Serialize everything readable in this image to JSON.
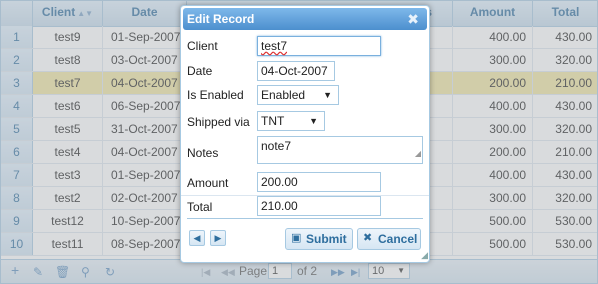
{
  "grid": {
    "columns": {
      "client": "Client",
      "date": "Date",
      "amount": "Amount",
      "total": "Total"
    },
    "partial_header": "s",
    "rows": [
      {
        "rn": "1",
        "client": "test9",
        "date": "01-Sep-2007",
        "amount": "400.00",
        "total": "430.00"
      },
      {
        "rn": "2",
        "client": "test8",
        "date": "03-Oct-2007",
        "amount": "300.00",
        "total": "320.00"
      },
      {
        "rn": "3",
        "client": "test7",
        "date": "04-Oct-2007",
        "amount": "200.00",
        "total": "210.00"
      },
      {
        "rn": "4",
        "client": "test6",
        "date": "06-Sep-2007",
        "amount": "400.00",
        "total": "430.00"
      },
      {
        "rn": "5",
        "client": "test5",
        "date": "31-Oct-2007",
        "amount": "300.00",
        "total": "320.00"
      },
      {
        "rn": "6",
        "client": "test4",
        "date": "04-Oct-2007",
        "amount": "200.00",
        "total": "210.00"
      },
      {
        "rn": "7",
        "client": "test3",
        "date": "01-Sep-2007",
        "amount": "400.00",
        "total": "430.00"
      },
      {
        "rn": "8",
        "client": "test2",
        "date": "02-Oct-2007",
        "amount": "300.00",
        "total": "320.00"
      },
      {
        "rn": "9",
        "client": "test12",
        "date": "10-Sep-2007",
        "amount": "500.00",
        "total": "530.00"
      },
      {
        "rn": "10",
        "client": "test11",
        "date": "08-Sep-2007",
        "amount": "500.00",
        "total": "530.00"
      }
    ],
    "selected_row": 3
  },
  "pager": {
    "page_label": "Page",
    "page_value": "1",
    "of_label": "of 2",
    "rows_per_page": "10",
    "icons": [
      "add-icon",
      "edit-icon",
      "delete-icon",
      "search-icon",
      "refresh-icon"
    ]
  },
  "dialog": {
    "title": "Edit Record",
    "fields": {
      "client_label": "Client",
      "client_value": "test7",
      "date_label": "Date",
      "date_value": "04-Oct-2007",
      "enabled_label": "Is Enabled",
      "enabled_value": "Enabled",
      "shipped_label": "Shipped via",
      "shipped_value": "TNT",
      "notes_label": "Notes",
      "notes_value": "note7",
      "amount_label": "Amount",
      "amount_value": "200.00",
      "total_label": "Total",
      "total_value": "210.00"
    },
    "submit_label": "Submit",
    "cancel_label": "Cancel"
  },
  "colors": {
    "header_text": "#2e6e9e",
    "selected_row": "#f1e5a0",
    "dialog_title": "#4c8fce"
  }
}
